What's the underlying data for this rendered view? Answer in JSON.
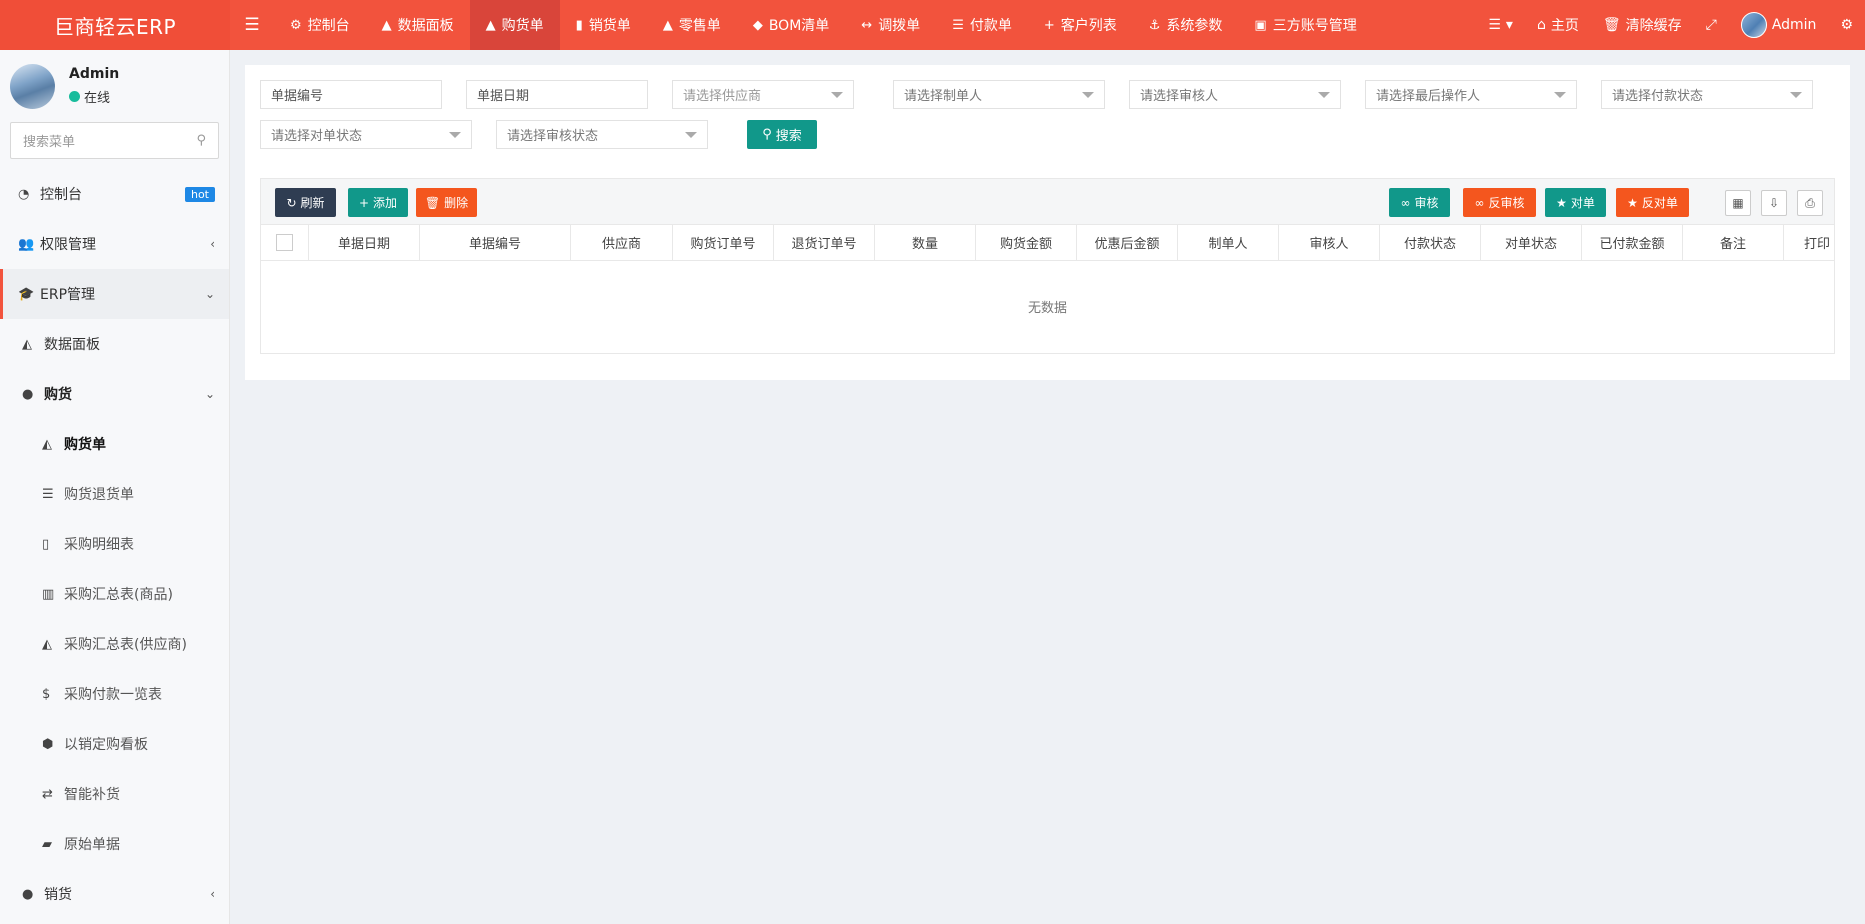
{
  "brand": "巨商轻云ERP",
  "nav": {
    "tabs": [
      {
        "icon": "⚙",
        "label": "控制台"
      },
      {
        "icon": "▲",
        "label": "数据面板"
      },
      {
        "icon": "▲",
        "label": "购货单"
      },
      {
        "icon": "▮",
        "label": "销货单"
      },
      {
        "icon": "▲",
        "label": "零售单"
      },
      {
        "icon": "◆",
        "label": "BOM清单"
      },
      {
        "icon": "↔",
        "label": "调拨单"
      },
      {
        "icon": "☰",
        "label": "付款单"
      },
      {
        "icon": "+",
        "label": "客户列表"
      },
      {
        "icon": "⚓",
        "label": "系统参数"
      },
      {
        "icon": "▣",
        "label": "三方账号管理"
      }
    ],
    "right": {
      "home": "主页",
      "clear_cache": "清除缓存",
      "user": "Admin"
    }
  },
  "sidebar": {
    "user_name": "Admin",
    "status": "在线",
    "search_placeholder": "搜索菜单",
    "items": [
      {
        "label": "控制台",
        "badge": "hot"
      },
      {
        "label": "权限管理"
      },
      {
        "label": "ERP管理"
      },
      {
        "label": "数据面板"
      },
      {
        "label": "购货"
      },
      {
        "label": "购货单"
      },
      {
        "label": "购货退货单"
      },
      {
        "label": "采购明细表"
      },
      {
        "label": "采购汇总表(商品)"
      },
      {
        "label": "采购汇总表(供应商)"
      },
      {
        "label": "采购付款一览表"
      },
      {
        "label": "以销定购看板"
      },
      {
        "label": "智能补货"
      },
      {
        "label": "原始单据"
      },
      {
        "label": "销货"
      }
    ]
  },
  "filters": {
    "bill_no": "单据编号",
    "bill_date": "单据日期",
    "supplier": "请选择供应商",
    "maker": "请选择制单人",
    "auditor": "请选择审核人",
    "last_operator": "请选择最后操作人",
    "pay_status": "请选择付款状态",
    "check_status": "请选择对单状态",
    "audit_status": "请选择审核状态",
    "search": "搜索"
  },
  "toolbar": {
    "refresh": "刷新",
    "add": "添加",
    "delete": "删除",
    "audit": "审核",
    "unaudit": "反审核",
    "check": "对单",
    "uncheck": "反对单"
  },
  "table": {
    "columns": [
      "单据日期",
      "单据编号",
      "供应商",
      "购货订单号",
      "退货订单号",
      "数量",
      "购货金额",
      "优惠后金额",
      "制单人",
      "审核人",
      "付款状态",
      "对单状态",
      "已付款金额",
      "备注",
      "打印"
    ],
    "empty": "无数据"
  },
  "colors": {
    "header": "#f2533d",
    "active_tab": "#d9453a",
    "teal": "#11988a",
    "orange": "#f4561e",
    "dark": "#2f3d52"
  }
}
